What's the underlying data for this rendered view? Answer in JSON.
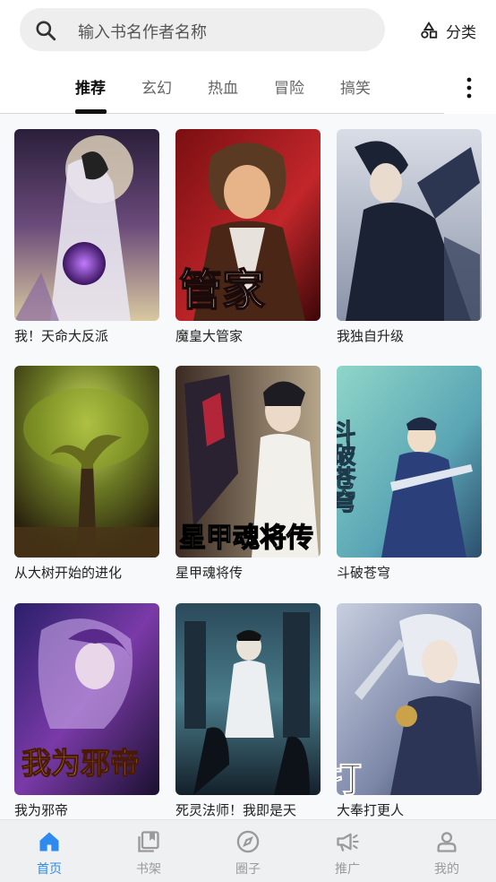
{
  "search": {
    "placeholder": "输入书名作者名称",
    "icon": "search-icon"
  },
  "header": {
    "category_label": "分类",
    "category_icon": "category-shapes-icon"
  },
  "tabs": [
    {
      "label": "推荐",
      "active": true
    },
    {
      "label": "玄幻",
      "active": false
    },
    {
      "label": "热血",
      "active": false
    },
    {
      "label": "冒险",
      "active": false
    },
    {
      "label": "搞笑",
      "active": false
    }
  ],
  "more_icon": "more-vertical-icon",
  "books": [
    {
      "title": "我！天命大反派"
    },
    {
      "title": "魔皇大管家",
      "cover_text": "管家"
    },
    {
      "title": "我独自升级"
    },
    {
      "title": "从大树开始的进化"
    },
    {
      "title": "星甲魂将传",
      "cover_text": "星甲魂将传"
    },
    {
      "title": "斗破苍穹",
      "cover_text": "斗破苍穹"
    },
    {
      "title": "我为邪帝",
      "cover_text": "我为邪帝"
    },
    {
      "title": "死灵法师！我即是天"
    },
    {
      "title": "大奉打更人",
      "cover_text": "打更人"
    }
  ],
  "bottom_nav": [
    {
      "label": "首页",
      "icon": "home-icon",
      "active": true
    },
    {
      "label": "书架",
      "icon": "bookshelf-icon",
      "active": false
    },
    {
      "label": "圈子",
      "icon": "compass-icon",
      "active": false
    },
    {
      "label": "推广",
      "icon": "megaphone-icon",
      "active": false
    },
    {
      "label": "我的",
      "icon": "user-icon",
      "active": false
    }
  ],
  "colors": {
    "accent": "#2d8bf0",
    "inactive": "#9a9a9a"
  }
}
